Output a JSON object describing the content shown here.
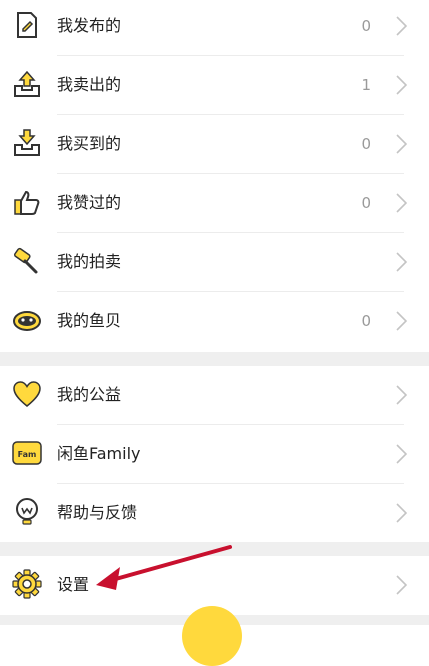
{
  "menu_group_1": [
    {
      "icon": "document-edit-icon",
      "label": "我发布的",
      "count": "0"
    },
    {
      "icon": "box-upload-icon",
      "label": "我卖出的",
      "count": "1"
    },
    {
      "icon": "box-download-icon",
      "label": "我买到的",
      "count": "0"
    },
    {
      "icon": "thumbs-up-icon",
      "label": "我赞过的",
      "count": "0"
    },
    {
      "icon": "auction-hammer-icon",
      "label": "我的拍卖",
      "count": ""
    },
    {
      "icon": "shell-icon",
      "label": "我的鱼贝",
      "count": "0"
    }
  ],
  "menu_group_2": [
    {
      "icon": "heart-icon",
      "label": "我的公益"
    },
    {
      "icon": "family-badge-icon",
      "label": "闲鱼Family",
      "badge_text": "Fam"
    },
    {
      "icon": "feedback-bulb-icon",
      "label": "帮助与反馈"
    }
  ],
  "menu_group_3": [
    {
      "icon": "gear-icon",
      "label": "设置"
    }
  ],
  "colors": {
    "accent": "#ffd93d",
    "icon_stroke": "#333333",
    "annotation_arrow": "#c8102e",
    "separator": "#efefef"
  }
}
